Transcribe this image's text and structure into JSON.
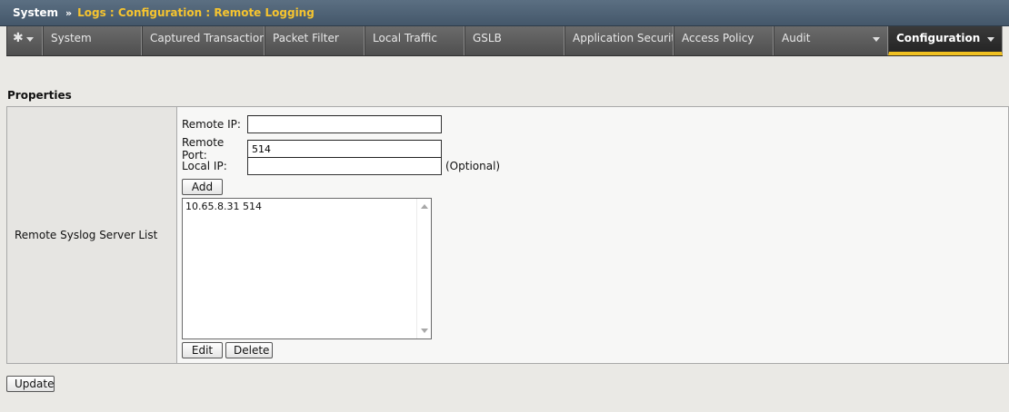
{
  "breadcrumb": {
    "root": "System",
    "separator": "»",
    "path": "Logs : Configuration : Remote Logging"
  },
  "tabs": [
    {
      "label": "System",
      "active": false,
      "has_menu": false
    },
    {
      "label": "Captured Transactions",
      "active": false,
      "has_menu": false
    },
    {
      "label": "Packet Filter",
      "active": false,
      "has_menu": false
    },
    {
      "label": "Local Traffic",
      "active": false,
      "has_menu": false
    },
    {
      "label": "GSLB",
      "active": false,
      "has_menu": false
    },
    {
      "label": "Application Security",
      "active": false,
      "has_menu": false
    },
    {
      "label": "Access Policy",
      "active": false,
      "has_menu": false
    },
    {
      "label": "Audit",
      "active": false,
      "has_menu": true
    },
    {
      "label": "Configuration",
      "active": true,
      "has_menu": true
    }
  ],
  "icons": {
    "gear": "gear-icon",
    "menu_caret": "chevron-down-icon"
  },
  "colors": {
    "active_tab_underline": "#f0c020",
    "breadcrumb_path": "#f6c42f"
  },
  "section": {
    "title": "Properties"
  },
  "form": {
    "row_label": "Remote Syslog Server List",
    "remote_ip": {
      "label": "Remote IP:",
      "value": ""
    },
    "remote_port": {
      "label": "Remote Port:",
      "value": "514"
    },
    "local_ip": {
      "label": "Local IP:",
      "value": "",
      "hint": "(Optional)"
    },
    "add_label": "Add",
    "server_list": [
      "10.65.8.31 514"
    ],
    "edit_label": "Edit",
    "delete_label": "Delete"
  },
  "update_label": "Update"
}
